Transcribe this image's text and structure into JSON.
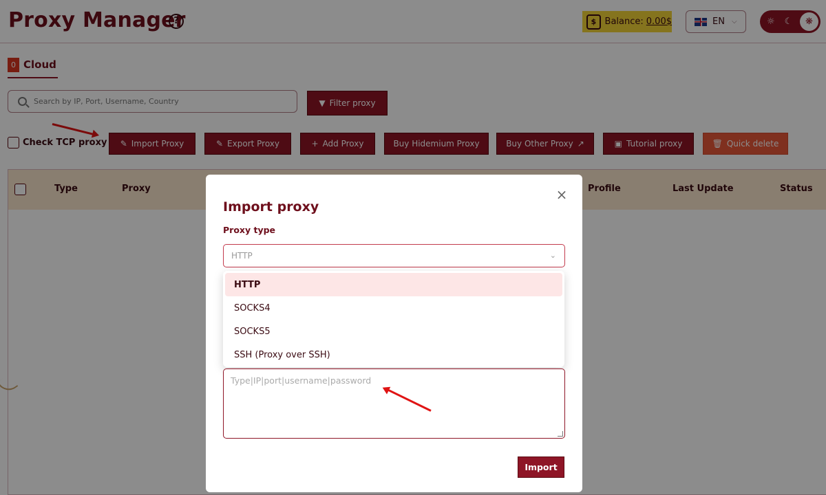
{
  "header": {
    "title": "Proxy Manager",
    "help_icon": "question-circle-icon",
    "balance_label": "Balance:",
    "balance_value": "0.00$",
    "language": "EN",
    "accent_color": "#8e1526",
    "balance_color": "#f2d338"
  },
  "tabs": [
    {
      "label": "Cloud",
      "count": "0"
    }
  ],
  "search": {
    "placeholder": "Search by IP, Port, Username, Country"
  },
  "toolbar": {
    "filter_label": "Filter proxy",
    "check_tcp_label": "Check TCP proxy",
    "import_label": "Import Proxy",
    "export_label": "Export Proxy",
    "add_label": "Add Proxy",
    "buy_hidemium_label": "Buy Hidemium Proxy",
    "buy_other_label": "Buy Other Proxy",
    "tutorial_label": "Tutorial proxy",
    "quick_delete_label": "Quick delete",
    "quick_delete_color": "#e8583a"
  },
  "table": {
    "columns": [
      "Type",
      "Proxy",
      "Profile",
      "Last Update",
      "Status"
    ]
  },
  "modal": {
    "title": "Import proxy",
    "proxy_type_label": "Proxy type",
    "selected_type": "HTTP",
    "options": [
      "HTTP",
      "SOCKS4",
      "SOCKS5",
      "SSH (Proxy over SSH)"
    ],
    "textarea_placeholder": "Type|IP|port|username|password",
    "import_button": "Import"
  }
}
